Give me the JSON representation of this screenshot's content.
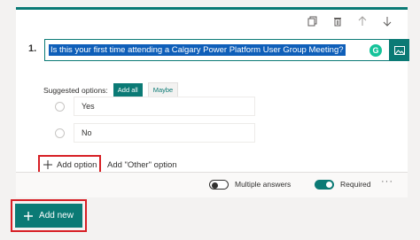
{
  "question": {
    "number": "1.",
    "title": "Is this your first time attending a Calgary Power Platform User Group Meeting?",
    "grammar_badge": "G"
  },
  "toolbar": {
    "icons": [
      "copy-icon",
      "delete-icon",
      "move-up-icon",
      "move-down-icon"
    ]
  },
  "suggested": {
    "label": "Suggested options:",
    "add_all": "Add all",
    "maybe": "Maybe"
  },
  "options": [
    {
      "value": "Yes"
    },
    {
      "value": "No"
    }
  ],
  "actions": {
    "add_option": "Add option",
    "add_other": "Add \"Other\" option"
  },
  "footer": {
    "multiple_answers": "Multiple answers",
    "multiple_answers_on": false,
    "required": "Required",
    "required_on": true,
    "more": "···"
  },
  "add_new": {
    "label": "Add new"
  },
  "colors": {
    "accent": "#0b7a75",
    "highlight_outline": "#d71f25",
    "selection": "#0f5fb9"
  }
}
